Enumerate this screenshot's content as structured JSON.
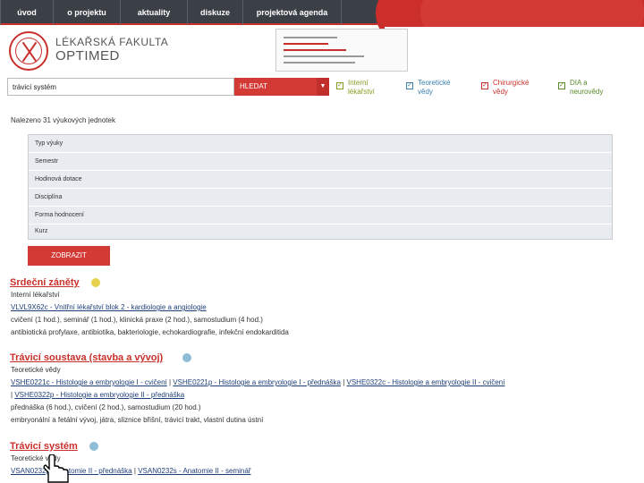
{
  "nav": {
    "items": [
      "úvod",
      "o projektu",
      "aktuality",
      "diskuze",
      "projektová agenda"
    ]
  },
  "header": {
    "brand_line1": "LÉKAŘSKÁ FAKULTA",
    "brand_line2": "OPTIMED"
  },
  "search": {
    "value": "trávicí systém",
    "button_label": "HLEDAT",
    "dropdown_glyph": "▼"
  },
  "categories": [
    {
      "label": "Interní lékařství",
      "color": "#8a9a20",
      "checked": true
    },
    {
      "label": "Teoretické vědy",
      "color": "#3a7fb0",
      "checked": true
    },
    {
      "label": "Chirurgické vědy",
      "color": "#c9302c",
      "checked": true
    },
    {
      "label": "DIA a neurovědy",
      "color": "#5a8a2a",
      "checked": true
    }
  ],
  "results_count": "Nalezeno 31 výukových jednotek",
  "filters": [
    "Typ výuky",
    "Semestr",
    "Hodinová dotace",
    "Disciplína",
    "Forma hodnocení",
    "Kurz"
  ],
  "show_button": "ZOBRAZIT",
  "colors": {
    "accent": "#c9302c",
    "nav_bg": "#3b3f46",
    "link": "#1f3f7a",
    "dot_yellow": "#e6d24a",
    "dot_blue": "#8fbcd6"
  },
  "results": [
    {
      "title": "Srdeční záněty",
      "dot_color": "#e6d24a",
      "category": "Interní lékařství",
      "link_lines": [
        [
          "VLVL9X62c - Vnitřní lékařství blok 2 - kardiologie a angiologie"
        ]
      ],
      "hours": "cvičení (1 hod.), seminář (1 hod.), klinická praxe (2 hod.), samostudium (4 hod.)",
      "keywords": "antibiotická profylaxe, antibiotika, bakteriologie, echokardiografie, infekční endokarditida"
    },
    {
      "title": "Trávicí soustava (stavba a vývoj)",
      "dot_color": "#8fbcd6",
      "category": "Teoretické vědy",
      "link_lines": [
        [
          "VSHE0221c - Histologie a embryologie I - cvičení",
          "VSHE0221p - Histologie a embryologie I - přednáška",
          "VSHE0322c - Histologie a embryologie II - cvičení"
        ],
        [
          "VSHE0322p - Histologie a embryologie II - přednáška"
        ]
      ],
      "hours": "přednáška (6 hod.), cvičení (2 hod.), samostudium (20 hod.)",
      "keywords": "embryonální a fetální vývoj, játra, sliznice břišní, trávicí trakt, vlastní dutina ústní"
    },
    {
      "title": "Trávicí systém",
      "dot_color": "#8fbcd6",
      "category": "Teoretické vědy",
      "link_lines": [
        [
          "VSAN0232p - Anatomie II - přednáška",
          "VSAN0232s - Anatomie II - seminář"
        ]
      ]
    }
  ]
}
